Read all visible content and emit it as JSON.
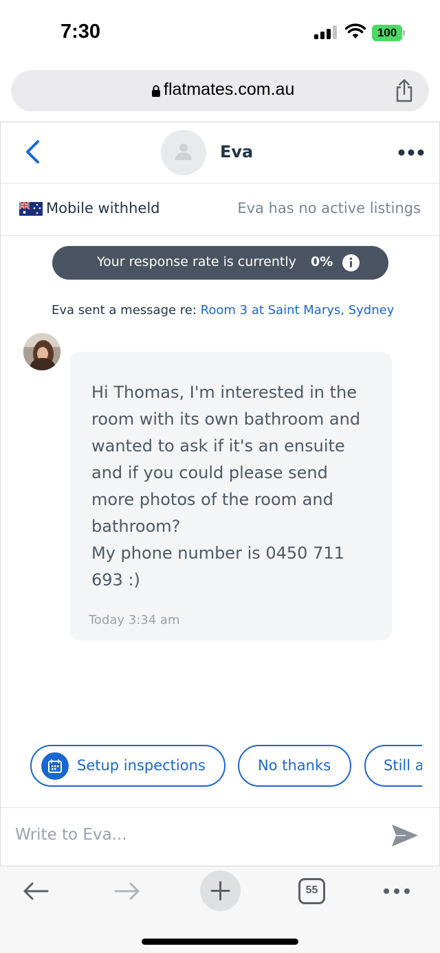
{
  "status_bar": {
    "time": "7:30",
    "battery": "100",
    "icons": [
      "signal-icon",
      "wifi-icon",
      "battery-icon"
    ]
  },
  "browser": {
    "url": "flatmates.com.au",
    "tab_count": "55",
    "icons": [
      "lock-icon",
      "share-icon",
      "back-arrow-icon",
      "forward-arrow-icon",
      "new-tab-icon",
      "tabs-icon",
      "more-icon"
    ]
  },
  "conversation": {
    "contact_name": "Eva",
    "mobile_status": "Mobile withheld",
    "listings_status": "Eva has no active listings",
    "response_rate_text": "Your response rate is currently",
    "response_rate_value": "0%",
    "sent_prefix": "Eva sent a message re:",
    "listing_link": "Room 3 at Saint Marys, Sydney"
  },
  "message": {
    "lines": [
      "Hi Thomas, I'm interested in the",
      "room with its own bathroom and",
      "wanted to ask if it's an ensuite",
      "and if you could please send",
      "more photos of the room and",
      "bathroom?",
      "My phone number is 0450 711",
      "693 :)"
    ],
    "timestamp": "Today 3:34 am"
  },
  "quick_replies": {
    "setup": "Setup inspections",
    "no_thanks": "No thanks",
    "still": "Still a"
  },
  "composer": {
    "placeholder": "Write to Eva..."
  },
  "colors": {
    "accent": "#1a66d2",
    "pill_bg": "#4a5361",
    "bubble_bg": "#f4f5f6",
    "battery": "#4cd964"
  }
}
